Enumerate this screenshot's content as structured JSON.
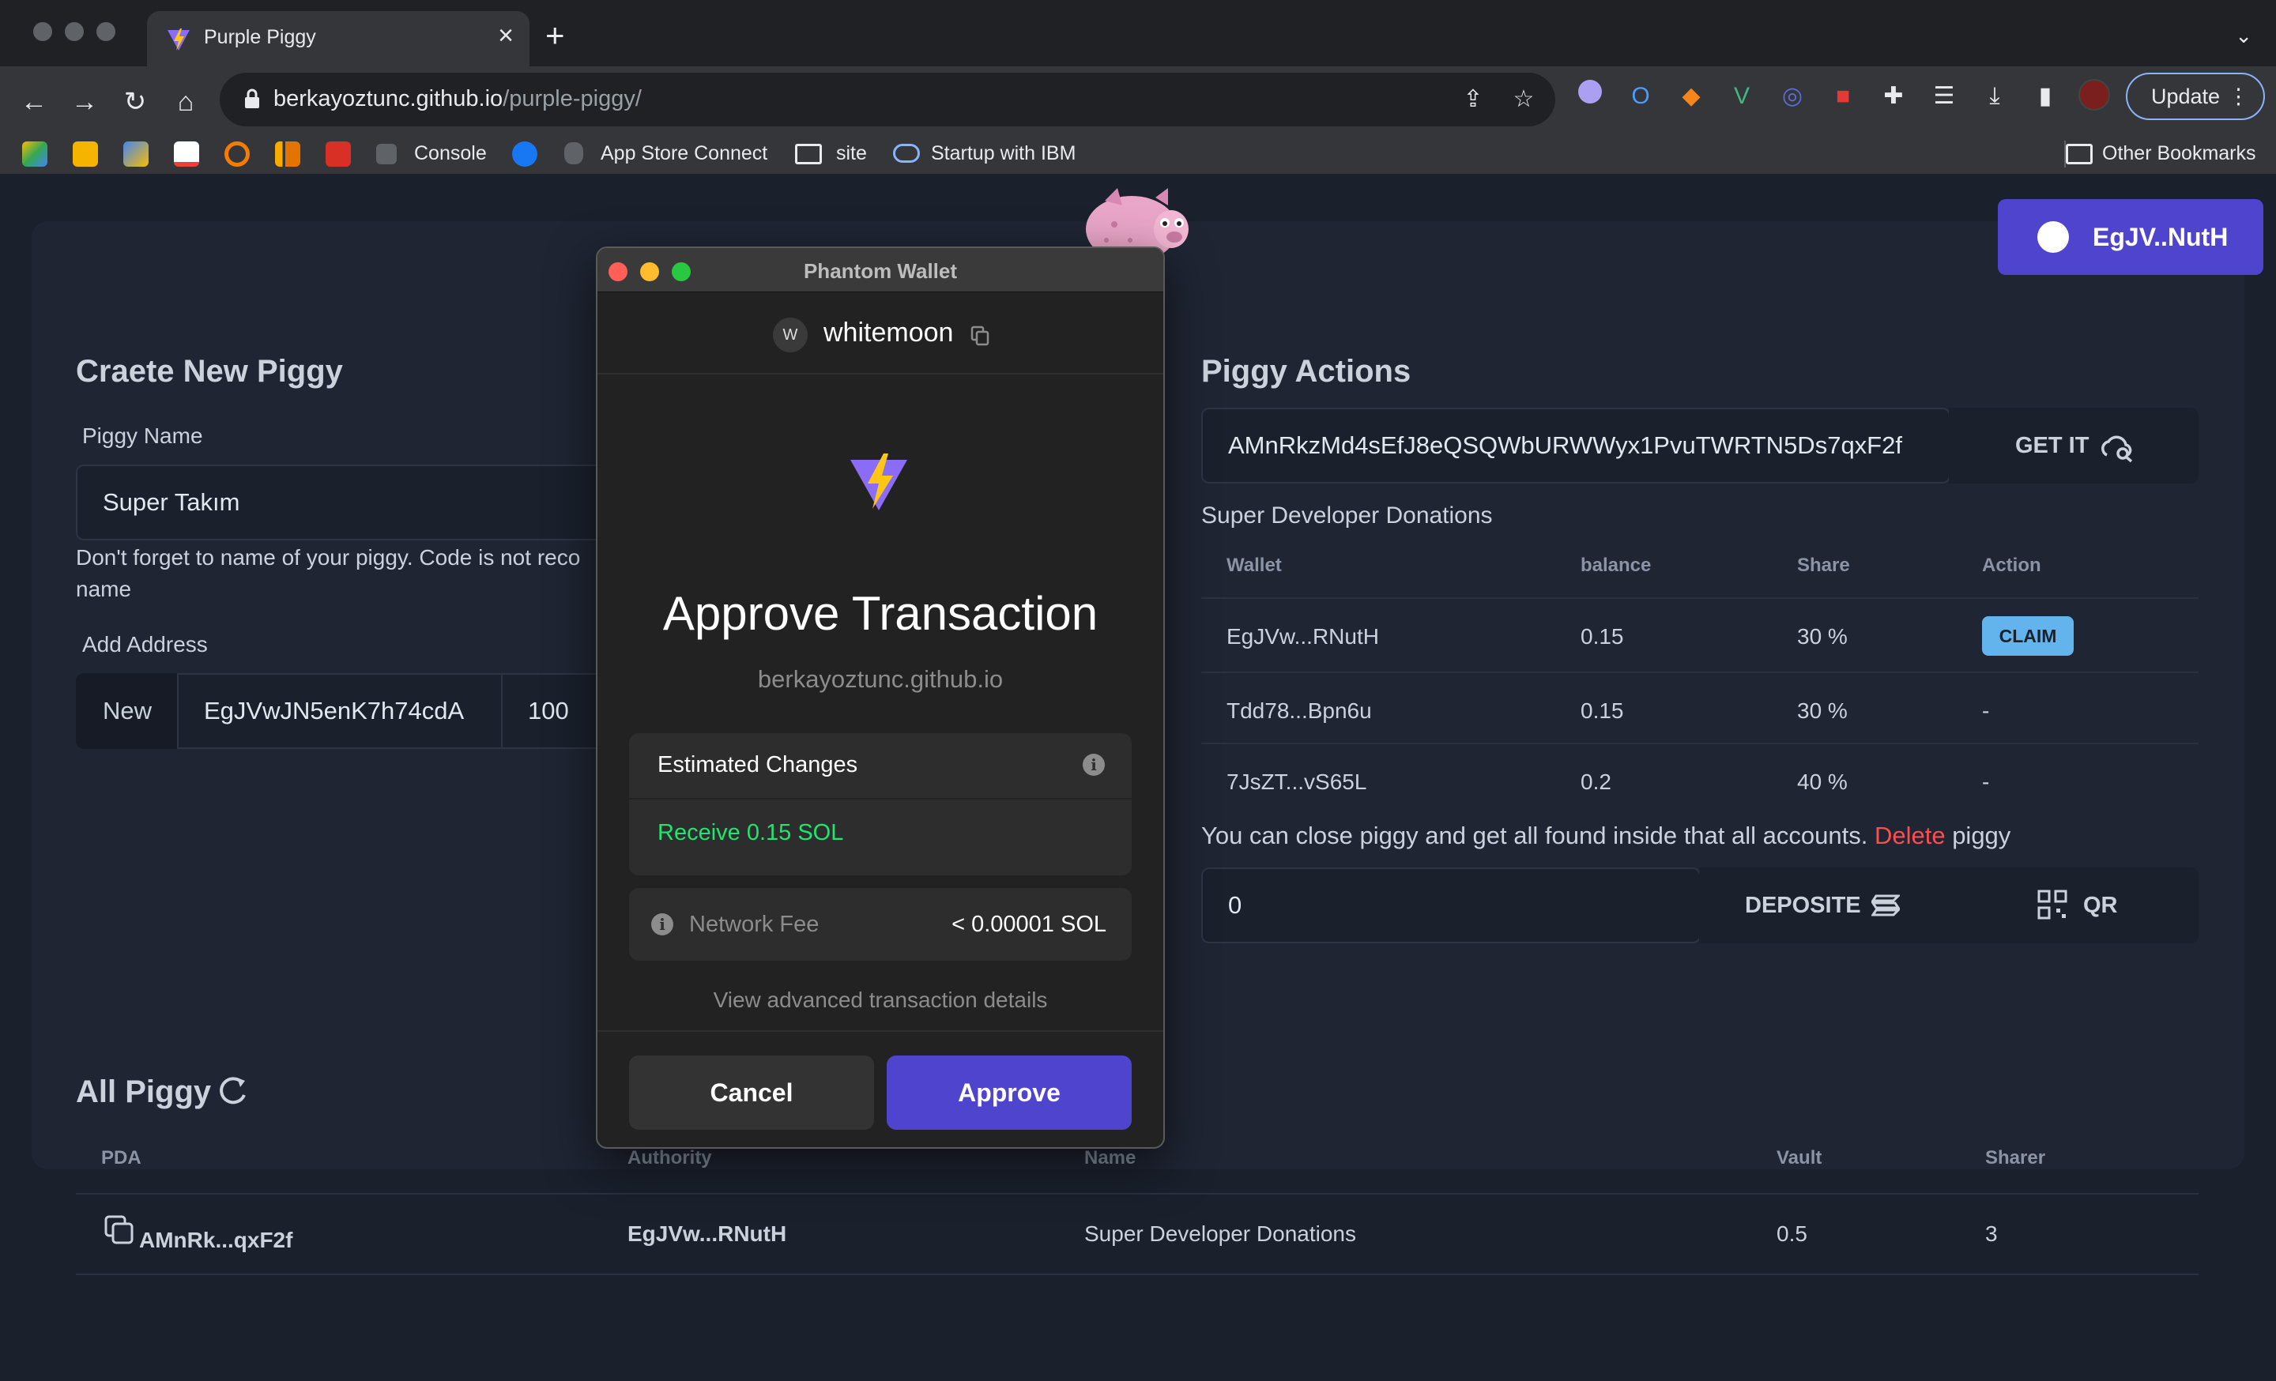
{
  "browser": {
    "tab_title": "Purple Piggy",
    "url_host": "berkayoztunc.github.io",
    "url_path": "/purple-piggy/",
    "update_label": "Update",
    "bookmarks": {
      "console": "Console",
      "app_store_connect": "App Store Connect",
      "site": "site",
      "startup_ibm": "Startup with IBM",
      "other": "Other Bookmarks"
    }
  },
  "header": {
    "wallet_button": "EgJV..NutH"
  },
  "create": {
    "title": "Craete New Piggy",
    "name_label": "Piggy Name",
    "name_value": "Super Takım",
    "helper_line1": "Don't forget to name of your piggy. Code is not reco",
    "helper_line2": "name",
    "address_label": "Add Address",
    "new_addon": "New",
    "address_value": "EgJVwJN5enK7h74cdA",
    "share_value": "100"
  },
  "actions": {
    "title": "Piggy Actions",
    "pda_value": "AMnRkzMd4sEfJ8eQSQWbURWWyx1PvuTWRTN5Ds7qxF2f",
    "get_it": "GET IT",
    "piggy_name": "Super Developer Donations",
    "table_headers": {
      "wallet": "Wallet",
      "balance": "balance",
      "share": "Share",
      "action": "Action"
    },
    "rows": [
      {
        "wallet": "EgJVw...RNutH",
        "balance": "0.15",
        "share": "30 %",
        "action": "CLAIM"
      },
      {
        "wallet": "Tdd78...Bpn6u",
        "balance": "0.15",
        "share": "30 %",
        "action": "-"
      },
      {
        "wallet": "7JsZT...vS65L",
        "balance": "0.2",
        "share": "40 %",
        "action": "-"
      }
    ],
    "close_text": "You can close piggy and get all found inside that all accounts.",
    "delete_text": "Delete",
    "piggy_word": "piggy",
    "deposit_value": "0",
    "deposite": "DEPOSITE",
    "qr": "QR"
  },
  "all": {
    "title": "All Piggy",
    "headers": {
      "pda": "PDA",
      "authority": "Authority",
      "name": "Name",
      "vault": "Vault",
      "sharer": "Sharer"
    },
    "rows": [
      {
        "pda": "AMnRk...qxF2f",
        "authority": "EgJVw...RNutH",
        "name": "Super Developer Donations",
        "vault": "0.5",
        "sharer": "3"
      }
    ]
  },
  "phantom": {
    "window_title": "Phantom Wallet",
    "account_initial": "W",
    "account_name": "whitemoon",
    "heading": "Approve Transaction",
    "origin": "berkayoztunc.github.io",
    "estimated_changes": "Estimated Changes",
    "receive": "Receive 0.15 SOL",
    "network_fee_label": "Network Fee",
    "network_fee_value": "< 0.00001 SOL",
    "advanced": "View advanced transaction details",
    "cancel": "Cancel",
    "approve": "Approve"
  },
  "colors": {
    "accent": "#4e44ce",
    "claim": "#63b3ed",
    "receive_green": "#21e56f",
    "delete_red": "#fc4e4e"
  }
}
